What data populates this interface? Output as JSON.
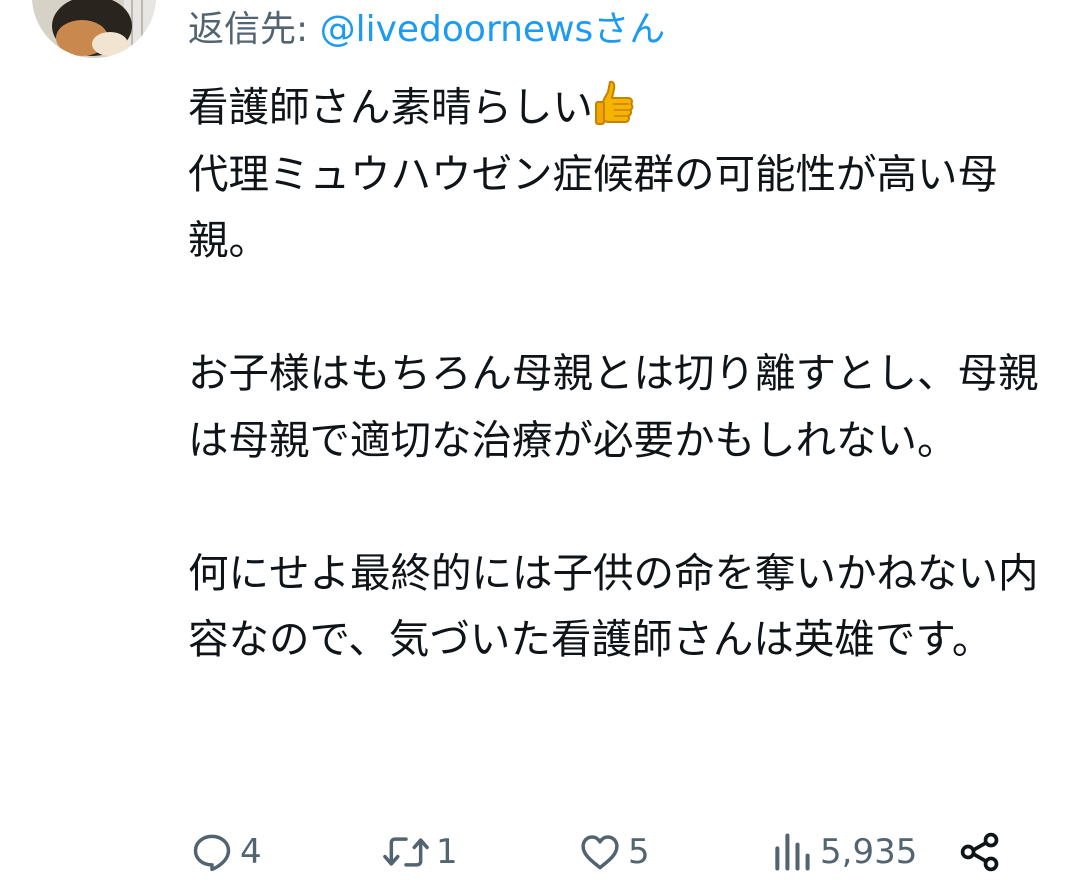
{
  "reply": {
    "prefix": "返信先: ",
    "handle": "@livedoornewsさん"
  },
  "tweet": {
    "paragraphs": [
      [
        "看護師さん素晴らしい",
        "代理ミュウハウゼン症候群の可能性が高い母親。"
      ],
      [
        "お子様はもちろん母親とは切り離すとし、母親は母親で適切な治療が必要かもしれない。"
      ],
      [
        "何にせよ最終的には子供の命を奪いかねない内容なので、気づいた看護師さんは英雄です。"
      ]
    ]
  },
  "icons": {
    "thumbs_up": "thumbs-up-emoji",
    "reply": "speech-bubble-icon",
    "retweet": "retweet-arrows-icon",
    "like": "heart-icon",
    "views": "bar-chart-icon",
    "share": "share-icon"
  },
  "actions": {
    "reply_count": "4",
    "retweet_count": "1",
    "like_count": "5",
    "views_count": "5,935"
  },
  "colors": {
    "text": "#0f1419",
    "muted": "#536471",
    "link": "#1d9bf0",
    "thumb": "#f4b400"
  }
}
